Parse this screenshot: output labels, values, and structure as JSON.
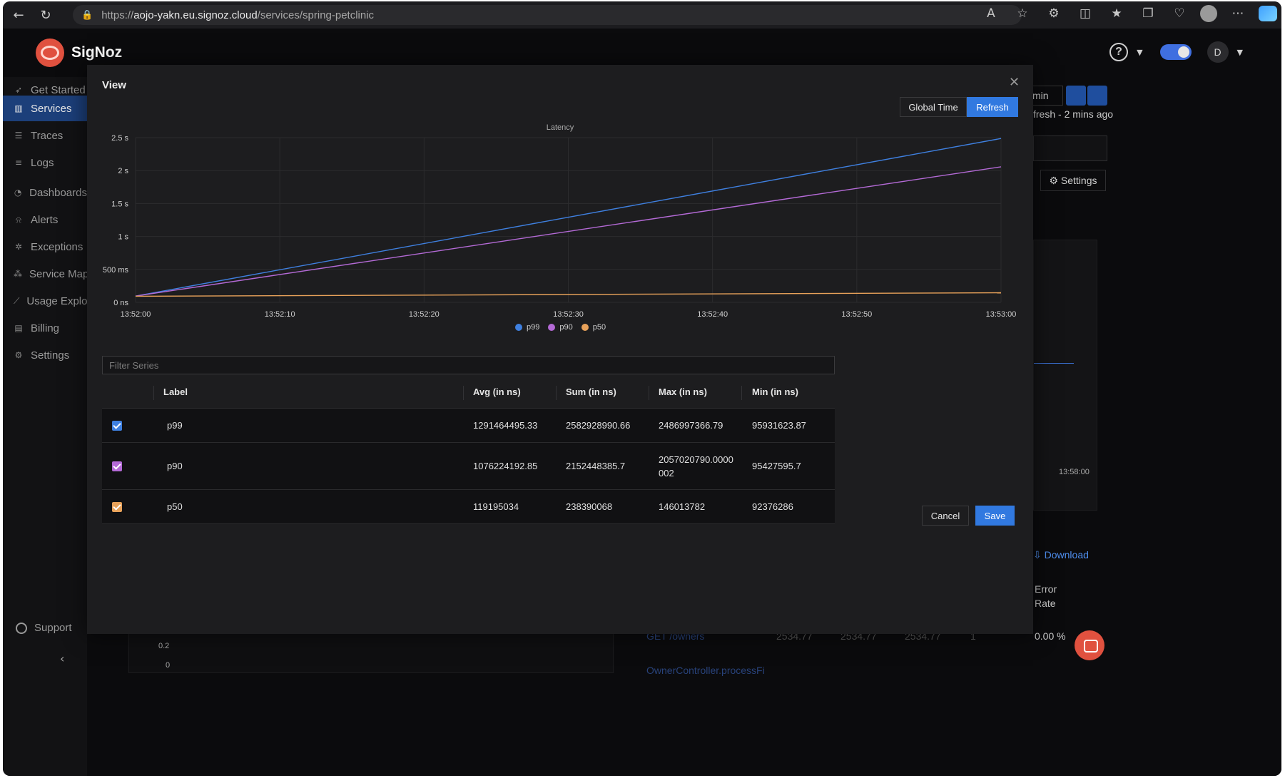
{
  "browser": {
    "url_prefix": "https://",
    "url_host": "aojo-yakn.eu.signoz.cloud",
    "url_path": "/services/spring-petclinic"
  },
  "app": {
    "name": "SigNoz",
    "avatar_initial": "D",
    "help_icon": "?"
  },
  "sidebar": {
    "items": [
      {
        "label": "Get Started",
        "icon": "rocket-icon"
      },
      {
        "label": "Services",
        "icon": "bar-chart-icon",
        "active": true
      },
      {
        "label": "Traces",
        "icon": "list-icon"
      },
      {
        "label": "Logs",
        "icon": "align-left-icon"
      },
      {
        "label": "Dashboards",
        "icon": "dashboard-icon"
      },
      {
        "label": "Alerts",
        "icon": "bell-icon"
      },
      {
        "label": "Exceptions",
        "icon": "bug-icon"
      },
      {
        "label": "Service Map",
        "icon": "deployment-icon"
      },
      {
        "label": "Usage Explorer",
        "icon": "line-chart-icon"
      },
      {
        "label": "Billing",
        "icon": "file-icon"
      },
      {
        "label": "Settings",
        "icon": "gear-icon"
      }
    ],
    "support_label": "Support"
  },
  "background": {
    "time_select": "min",
    "last_refresh": "fresh - 2 mins ago",
    "settings_label": "Settings",
    "time_tick": "13:58:00",
    "download_label": "Download",
    "error_rate_header": "Error Rate",
    "error_rate_value": "0.00 %",
    "row_link_1": "GET /owners",
    "row_link_2": "OwnerController.processFi",
    "row_values": [
      "2534.77",
      "2534.77",
      "2534.77",
      "1"
    ],
    "axis_0_2": "0.2",
    "axis_0": "0"
  },
  "modal": {
    "title": "View",
    "global_time_label": "Global Time",
    "refresh_label": "Refresh",
    "filter_placeholder": "Filter Series",
    "cancel_label": "Cancel",
    "save_label": "Save"
  },
  "table": {
    "headers": [
      "Label",
      "Avg (in ns)",
      "Sum (in ns)",
      "Max (in ns)",
      "Min (in ns)"
    ],
    "rows": [
      {
        "label": "p99",
        "color": "#3f80e0",
        "avg": "1291464495.33",
        "sum": "2582928990.66",
        "max": "2486997366.79",
        "min": "95931623.87"
      },
      {
        "label": "p90",
        "color": "#b46ad6",
        "avg": "1076224192.85",
        "sum": "2152448385.7",
        "max": "2057020790.0000002",
        "min": "95427595.7"
      },
      {
        "label": "p50",
        "color": "#e8a25a",
        "avg": "119195034",
        "sum": "238390068",
        "max": "146013782",
        "min": "92376286"
      }
    ]
  },
  "chart_data": {
    "type": "line",
    "title": "Latency",
    "x": [
      "13:52:00",
      "13:53:00"
    ],
    "x_ticks": [
      "13:52:00",
      "13:52:10",
      "13:52:20",
      "13:52:30",
      "13:52:40",
      "13:52:50",
      "13:53:00"
    ],
    "y_ticks": [
      "0 ns",
      "500 ms",
      "1 s",
      "1.5 s",
      "2 s",
      "2.5 s"
    ],
    "ylim_ms": [
      0,
      2500
    ],
    "series": [
      {
        "name": "p99",
        "color": "#3f80e0",
        "values_ms": [
          95.93,
          2486.99
        ]
      },
      {
        "name": "p90",
        "color": "#b46ad6",
        "values_ms": [
          95.43,
          2057.02
        ]
      },
      {
        "name": "p50",
        "color": "#e8a25a",
        "values_ms": [
          92.38,
          146.01
        ]
      }
    ],
    "grid": true,
    "legend": "bottom"
  }
}
